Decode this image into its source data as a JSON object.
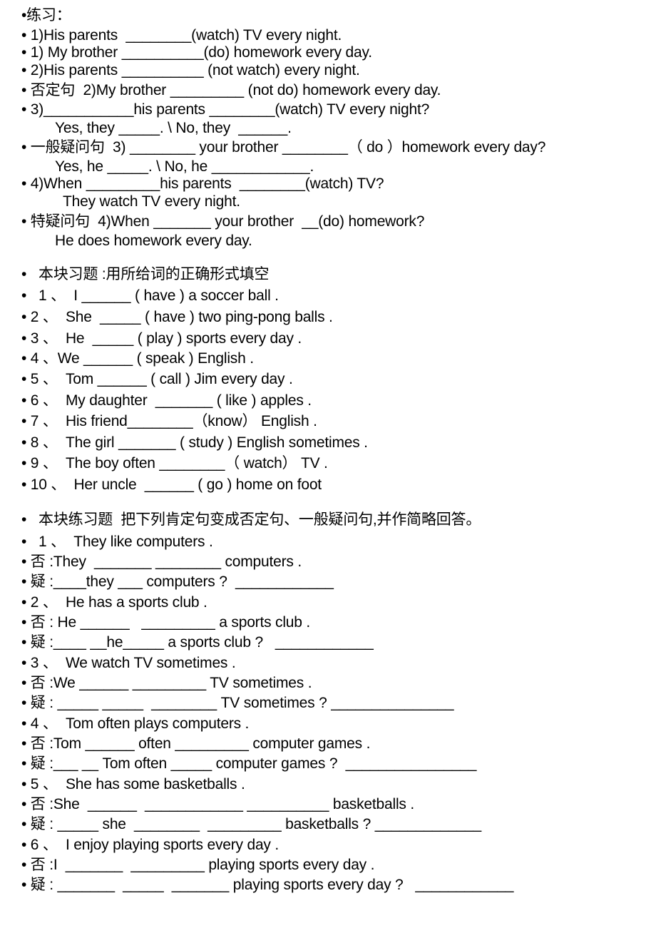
{
  "document": {
    "lines": [
      "•练习：",
      "• 1)His parents  ________(watch) TV every night.",
      "• 1) My brother __________(do) homework every day.",
      "• 2)His parents __________ (not watch) every night.",
      "• 否定句  2)My brother _________ (not do) homework every day.",
      "• 3)___________his parents ________(watch) TV every night?",
      "Yes, they _____. \\ No, they  ______.",
      "• 一般疑问句  3) ________ your brother ________（ do ）homework every day?",
      "Yes, he _____. \\ No, he ____________.",
      "• 4)When _________his parents  ________(watch) TV?",
      "They watch TV every night.",
      "• 特疑问句  4)When _______ your brother  __(do) homework?",
      "He does homework every day.",
      "•   本块习题 :用所给词的正确形式填空",
      "•   1 、  I ______ ( have ) a soccer ball .",
      "• 2 、  She  _____ ( have ) two ping-pong balls .",
      "• 3 、  He  _____ ( play ) sports every day .",
      "• 4 、We ______ ( speak ) English .",
      "• 5 、  Tom ______ ( call ) Jim every day .",
      "• 6 、  My daughter  _______ ( like ) apples .",
      "• 7 、  His friend________（know） English .",
      "• 8 、  The girl _______ ( study ) English sometimes .",
      "• 9 、  The boy often ________（ watch） TV .",
      "• 10 、  Her uncle  ______ ( go ) home on foot",
      "•   本块练习题  把下列肯定句变成否定句、一般疑问句,并作简略回答。",
      "•   1 、  They like computers .",
      "• 否 :They  _______ ________ computers .",
      "• 疑 :____they ___ computers ?  ____________",
      "• 2 、  He has a sports club .",
      "• 否 : He ______   _________ a sports club .",
      "• 疑 :____ __he_____ a sports club ?   ____________",
      "• 3 、  We watch TV sometimes .",
      "• 否 :We ______ _________ TV sometimes .",
      "• 疑 : _____ _____  ________ TV sometimes ? _______________",
      "• 4 、  Tom often plays computers .",
      "• 否 :Tom ______ often _________ computer games .",
      "• 疑 :___ __ Tom often _____ computer games ?  ________________",
      "• 5 、  She has some basketballs .",
      "• 否 :She  ______  ____________ __________ basketballs .",
      "• 疑 : _____ she  ________  _________ basketballs ? _____________",
      "• 6 、  I enjoy playing sports every day .",
      "• 否 :I  _______  _________ playing sports every day .",
      "• 疑 : _______  _____  _______ playing sports every day ?   ____________"
    ]
  }
}
